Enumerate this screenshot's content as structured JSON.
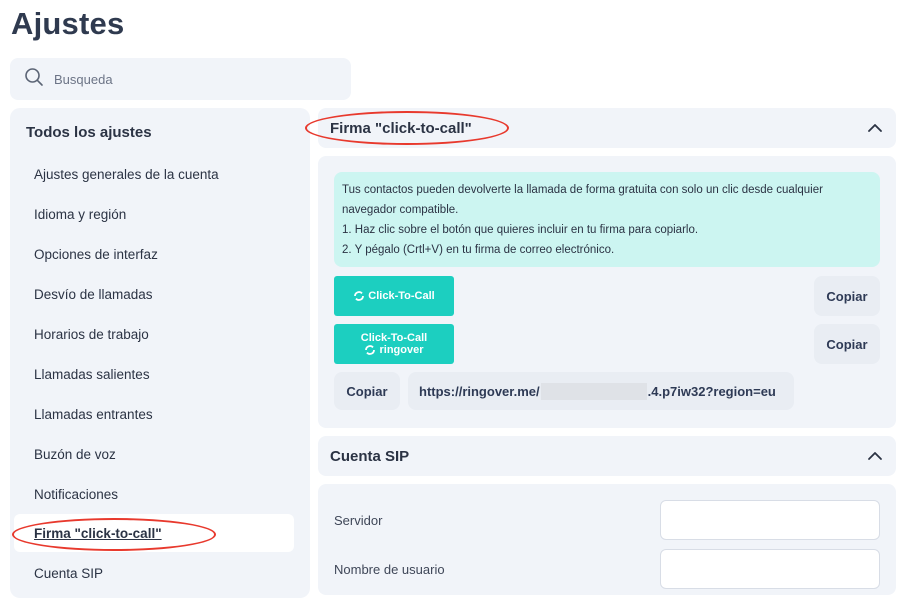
{
  "page": {
    "title": "Ajustes"
  },
  "search": {
    "placeholder": "Busqueda"
  },
  "sidebar": {
    "title": "Todos los ajustes",
    "items": [
      {
        "label": "Ajustes generales de la cuenta"
      },
      {
        "label": "Idioma y región"
      },
      {
        "label": "Opciones de interfaz"
      },
      {
        "label": "Desvío de llamadas"
      },
      {
        "label": "Horarios de trabajo"
      },
      {
        "label": "Llamadas salientes"
      },
      {
        "label": "Llamadas entrantes"
      },
      {
        "label": "Buzón de voz"
      },
      {
        "label": "Notificaciones"
      },
      {
        "label": "Firma \"click-to-call\"",
        "active": true
      },
      {
        "label": "Cuenta SIP"
      }
    ]
  },
  "firma_section": {
    "title": "Firma \"click-to-call\"",
    "info_lines": [
      "Tus contactos pueden devolverte la llamada de forma gratuita con solo un clic desde cualquier",
      "navegador compatible.",
      "1. Haz clic sobre el botón que quieres incluir en tu firma para copiarlo.",
      "2. Y pégalo (Crtl+V) en tu firma de correo electrónico."
    ],
    "button1_label": "Click-To-Call",
    "button2_line1": "Click-To-Call",
    "button2_brand": "ringover",
    "copy_label": "Copiar",
    "url_prefix": "https://ringover.me/",
    "url_suffix": ".4.p7iw32?region=eu"
  },
  "sip_section": {
    "title": "Cuenta SIP",
    "fields": [
      {
        "label": "Servidor",
        "value": ""
      },
      {
        "label": "Nombre de usuario",
        "value": ""
      }
    ]
  },
  "colors": {
    "accent": "#1ccfc0",
    "highlight_oval": "#e8392d",
    "panel_bg": "#f1f4f9",
    "info_bg": "#ccf5f1"
  },
  "icons": {
    "search": "search-icon",
    "collapse": "chevron-up-icon",
    "brand": "ringover-logo-icon"
  }
}
